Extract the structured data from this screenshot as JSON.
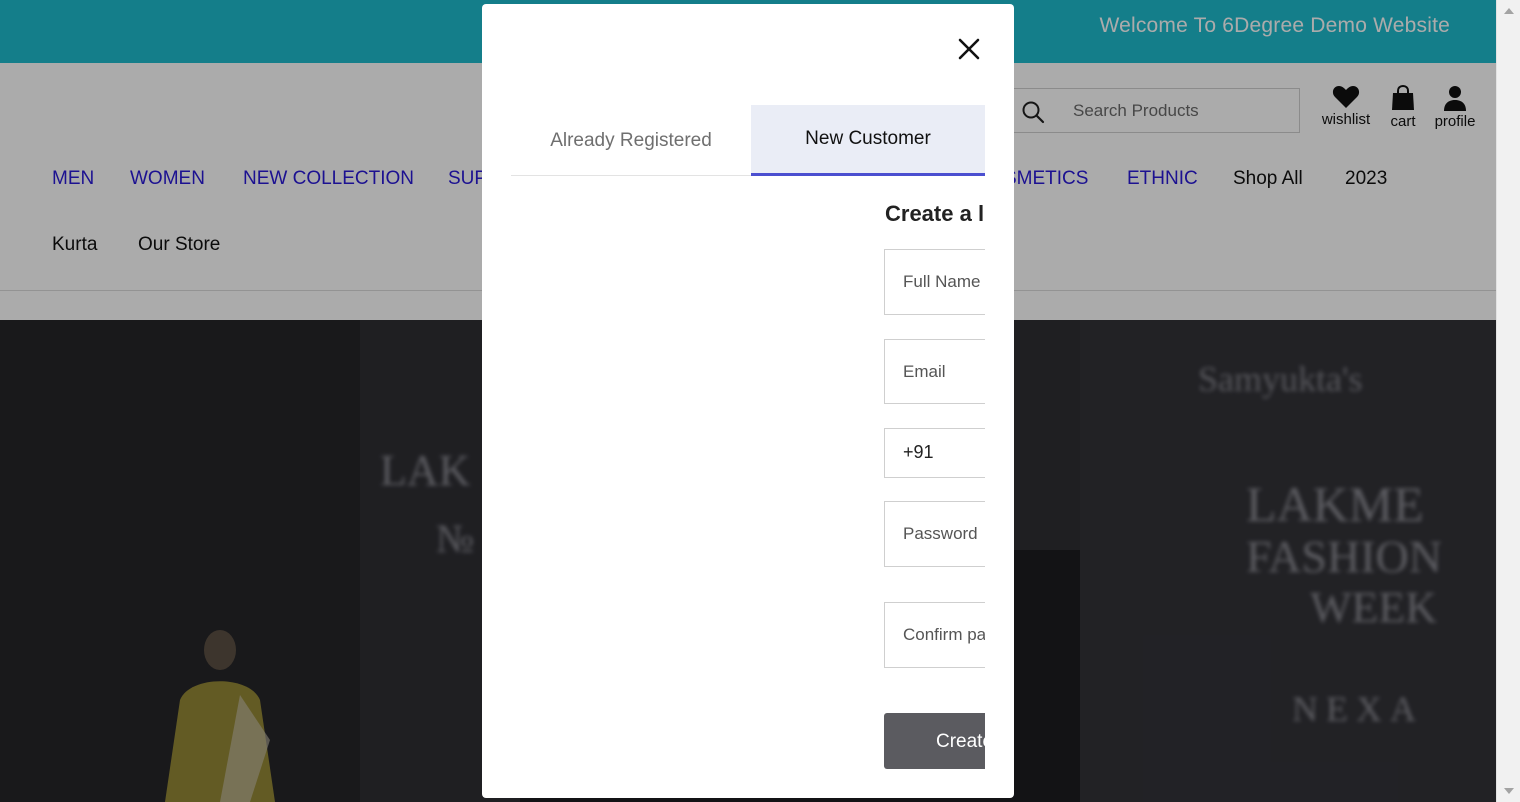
{
  "topbar": {
    "welcome_text": "Welcome To 6Degree Demo Website",
    "color": "#1fbcce"
  },
  "header": {
    "search": {
      "placeholder": "Search Products"
    },
    "icons": {
      "wishlist": "wishlist",
      "cart": "cart",
      "profile": "profile"
    }
  },
  "nav": {
    "row1": [
      "MEN",
      "WOMEN",
      "NEW COLLECTION",
      "SUP",
      "SMETICS",
      "ETHNIC",
      "Shop All",
      "2023"
    ],
    "row2": [
      "Kurta",
      "Our Store"
    ]
  },
  "hero": {
    "left_text": "LAK",
    "left_text_2": "№ I",
    "right_brand": "Samyukta's",
    "right_text_1": "LAKME",
    "right_text_2": "FASHION",
    "right_text_3": "WEEK",
    "right_text_4": "NEXA"
  },
  "modal": {
    "tabs": {
      "already_registered": "Already Registered",
      "new_customer": "New Customer"
    },
    "form_title": "Create a l",
    "fields": {
      "full_name_placeholder": "Full Name",
      "email_placeholder": "Email",
      "phone_code": "+91",
      "password_placeholder": "Password",
      "confirm_placeholder": "Confirm pa"
    },
    "create_button": "Create",
    "accent": "#4b4fd0",
    "button_color": "#5b5b60"
  }
}
